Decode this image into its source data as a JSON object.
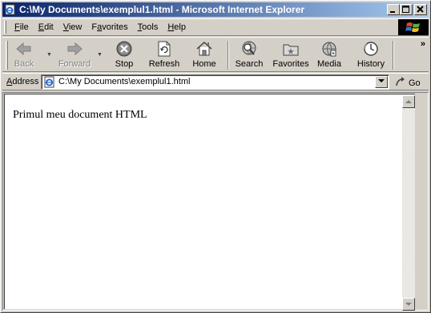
{
  "window": {
    "title": "C:\\My Documents\\exemplul1.html - Microsoft Internet Explorer",
    "controls": {
      "minimize": "_",
      "maximize": "□",
      "close": "×"
    }
  },
  "menu": {
    "items": [
      {
        "accel": "F",
        "rest": "ile"
      },
      {
        "accel": "E",
        "rest": "dit"
      },
      {
        "accel": "V",
        "rest": "iew"
      },
      {
        "pre": "F",
        "accel": "a",
        "rest": "vorites"
      },
      {
        "accel": "T",
        "rest": "ools"
      },
      {
        "accel": "H",
        "rest": "elp"
      }
    ]
  },
  "toolbar": {
    "back": "Back",
    "forward": "Forward",
    "stop": "Stop",
    "refresh": "Refresh",
    "home": "Home",
    "search": "Search",
    "favorites": "Favorites",
    "media": "Media",
    "history": "History",
    "more": "»"
  },
  "address": {
    "label_accel": "A",
    "label_rest": "ddress",
    "value": "C:\\My Documents\\exemplul1.html",
    "go": "Go"
  },
  "document": {
    "text": "Primul meu document HTML"
  },
  "icons": {
    "title": "ie-page-icon",
    "logo": "windows-flag-logo",
    "back": "back-arrow-icon",
    "forward": "forward-arrow-icon",
    "stop": "stop-icon",
    "refresh": "refresh-icon",
    "home": "home-icon",
    "search": "search-globe-icon",
    "favorites": "favorites-folder-icon",
    "media": "media-globe-icon",
    "history": "history-clock-icon",
    "go": "go-arrow-icon"
  },
  "colors": {
    "titlebar_start": "#0a246a",
    "titlebar_end": "#a6caf0",
    "chrome": "#d4d0c8"
  }
}
